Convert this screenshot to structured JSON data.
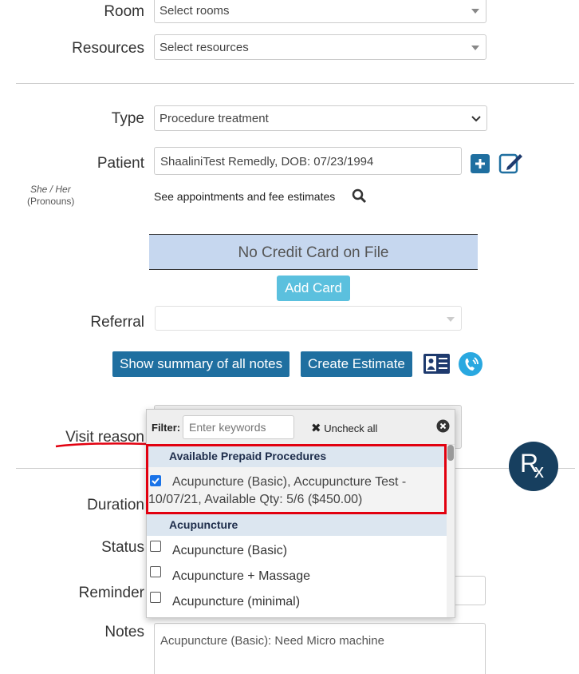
{
  "form": {
    "room_label": "Room",
    "room_placeholder": "Select rooms",
    "resources_label": "Resources",
    "resources_placeholder": "Select resources",
    "type_label": "Type",
    "type_value": "Procedure treatment",
    "patient_label": "Patient",
    "patient_value": "ShaaliniTest Remedly, DOB: 07/23/1994",
    "pronouns_value": "She / Her",
    "pronouns_caption": "(Pronouns)",
    "appointments_link": "See appointments and fee estimates",
    "credit_card_status": "No Credit Card on File",
    "add_card_label": "Add Card",
    "referral_label": "Referral",
    "summary_button": "Show summary of all notes",
    "estimate_button": "Create Estimate",
    "visit_reason_label": "Visit reason",
    "duration_label": "Duration",
    "status_label": "Status",
    "reminder_label": "Reminder",
    "notes_label": "Notes",
    "notes_value": "Acupuncture (Basic): Need Micro machine"
  },
  "dropdown": {
    "filter_label": "Filter:",
    "filter_placeholder": "Enter keywords",
    "uncheck_all_label": "Uncheck all",
    "groups": [
      {
        "title": "Available Prepaid Procedures",
        "options": [
          {
            "line1": "Acupuncture (Basic), Accupuncture Test -",
            "line2": "10/07/21, Available Qty: 5/6 ($450.00)",
            "checked": true
          }
        ]
      },
      {
        "title": "Acupuncture",
        "options": [
          {
            "label": "Acupuncture (Basic)",
            "checked": false
          },
          {
            "label": "Acupuncture + Massage",
            "checked": false
          },
          {
            "label": "Acupuncture (minimal)",
            "checked": false
          }
        ]
      }
    ]
  },
  "rx_badge": {
    "r": "R",
    "x": "x"
  },
  "colors": {
    "primary_button": "#1f6fa0",
    "add_card": "#5bc0de",
    "card_banner": "#c6d7ef",
    "highlight_box": "#e2000f",
    "rx_badge": "#173f5f"
  }
}
